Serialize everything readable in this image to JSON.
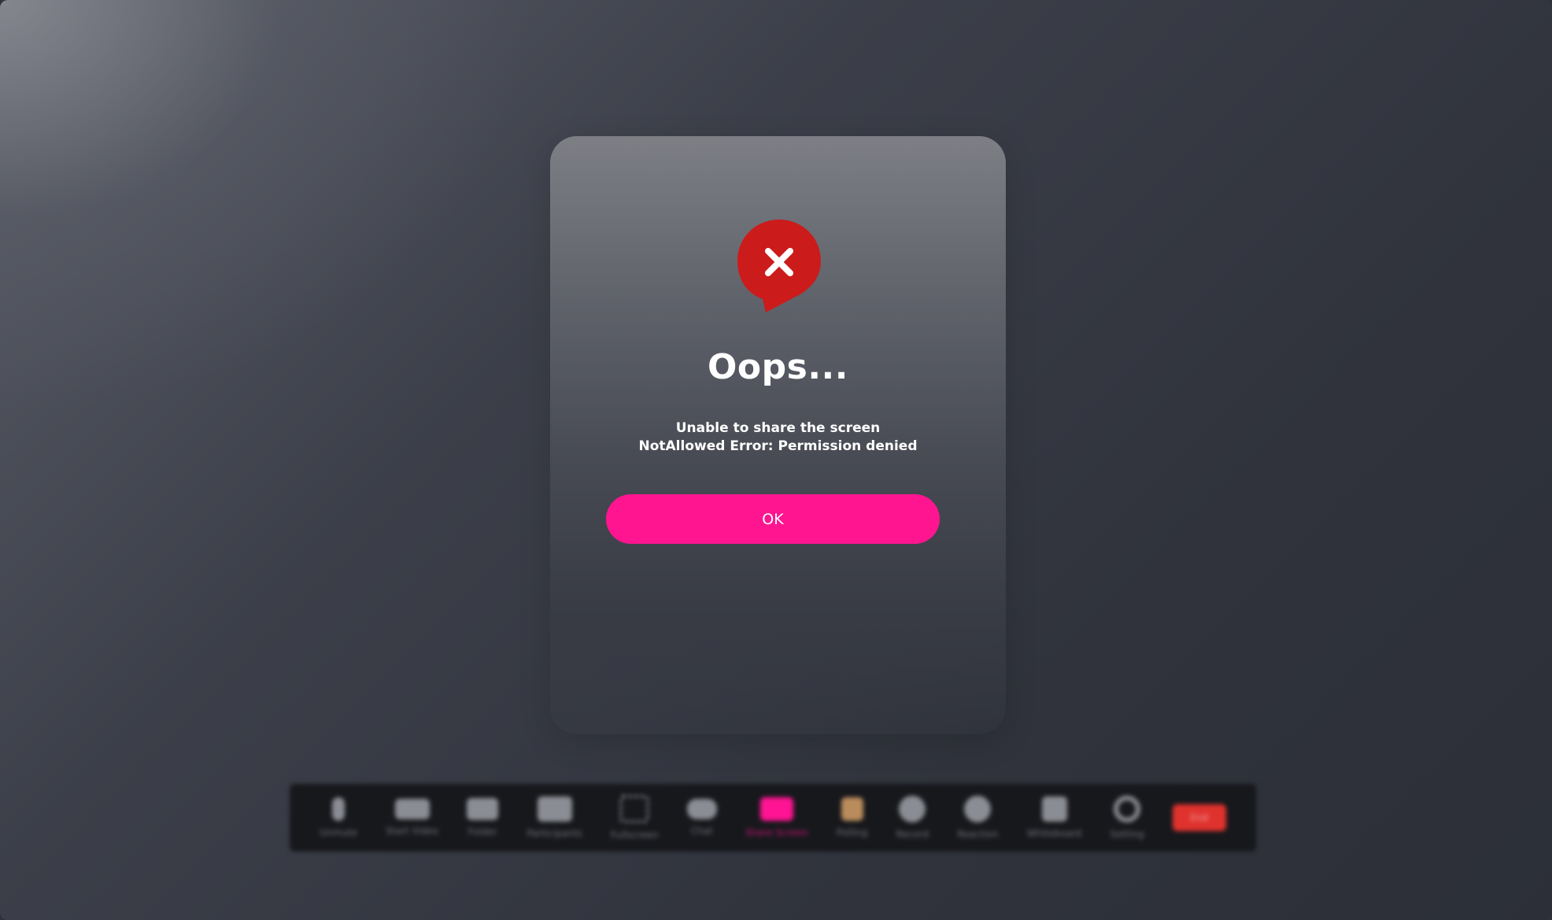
{
  "dialog": {
    "title": "Oops...",
    "message_line1": "Unable to share the screen",
    "message_line2": "NotAllowed Error: Permission denied",
    "ok_label": "OK",
    "icon": "error-x-icon"
  },
  "colors": {
    "accent": "#ff1590",
    "error": "#cc1b1b",
    "end_button": "#e0322d"
  },
  "toolbar": {
    "items": [
      {
        "label": "Unmute",
        "icon": "microphone-icon"
      },
      {
        "label": "Start Video",
        "icon": "video-camera-icon"
      },
      {
        "label": "Folder",
        "icon": "folder-icon"
      },
      {
        "label": "Participants",
        "icon": "participants-icon"
      },
      {
        "label": "Fullscreen",
        "icon": "fullscreen-icon"
      },
      {
        "label": "Chat",
        "icon": "chat-icon"
      },
      {
        "label": "Share Screen",
        "icon": "share-screen-icon"
      },
      {
        "label": "Polling",
        "icon": "polling-icon"
      },
      {
        "label": "Record",
        "icon": "record-icon"
      },
      {
        "label": "Reaction",
        "icon": "reaction-icon"
      },
      {
        "label": "Whiteboard",
        "icon": "whiteboard-icon"
      },
      {
        "label": "Setting",
        "icon": "gear-icon"
      }
    ],
    "end_label": "End"
  }
}
